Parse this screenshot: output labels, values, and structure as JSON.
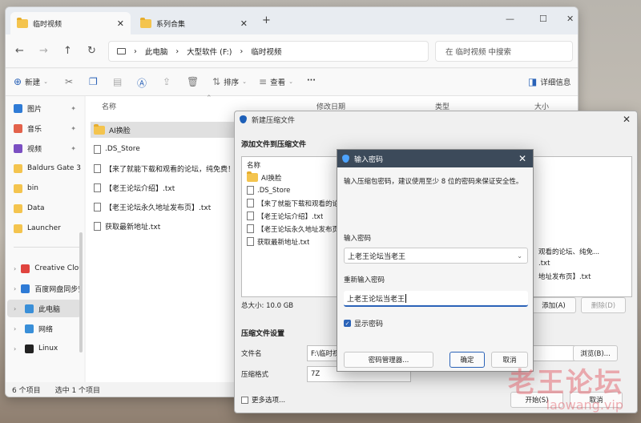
{
  "explorer": {
    "tabs": [
      {
        "label": "临时视频",
        "close": "✕"
      },
      {
        "label": "系列合集",
        "close": "✕"
      }
    ],
    "new_tab": "+",
    "window_controls": {
      "minimize": "—",
      "maximize": "☐",
      "close": "✕"
    },
    "nav_icons": {
      "back": "←",
      "forward": "→",
      "up": "↑",
      "refresh": "↻"
    },
    "breadcrumb": [
      "此电脑",
      "大型软件 (F:)",
      "临时视频"
    ],
    "breadcrumb_sep": "›",
    "search_placeholder": "在 临时视频 中搜索",
    "toolbar": {
      "new_label": "新建",
      "sort_label": "排序",
      "view_label": "查看",
      "more_label": "···",
      "details_label": "详细信息"
    },
    "sidebar": {
      "quick": [
        {
          "label": "图片",
          "icon": "pictures-icon",
          "color": "#2f7bd6"
        },
        {
          "label": "音乐",
          "icon": "music-icon",
          "color": "#e3624b"
        },
        {
          "label": "视频",
          "icon": "videos-icon",
          "color": "#7b4fc2"
        },
        {
          "label": "Baldurs Gate 3",
          "icon": "folder-icon",
          "color": "#f4c44e"
        },
        {
          "label": "bin",
          "icon": "folder-icon",
          "color": "#f4c44e"
        },
        {
          "label": "Data",
          "icon": "folder-icon",
          "color": "#f4c44e"
        },
        {
          "label": "Launcher",
          "icon": "folder-icon",
          "color": "#f4c44e"
        }
      ],
      "tree": [
        {
          "label": "Creative Cloud",
          "icon": "creative-cloud-icon",
          "color": "#e0443e"
        },
        {
          "label": "百度网盘同步空",
          "icon": "baidu-netdisk-icon",
          "color": "#2f7bd6"
        },
        {
          "label": "此电脑",
          "icon": "this-pc-icon",
          "color": "#3a8fd8"
        },
        {
          "label": "网络",
          "icon": "network-icon",
          "color": "#3a8fd8"
        },
        {
          "label": "Linux",
          "icon": "linux-icon",
          "color": "#222222"
        }
      ]
    },
    "columns": {
      "name": "名称",
      "modified": "修改日期",
      "type": "类型",
      "size": "大小"
    },
    "files": [
      {
        "name": "AI换脸",
        "kind": "folder"
      },
      {
        "name": ".DS_Store",
        "kind": "file"
      },
      {
        "name": "【来了就能下载和观看的论坛，纯免费！】.txt",
        "kind": "file"
      },
      {
        "name": "【老王论坛介绍】.txt",
        "kind": "file"
      },
      {
        "name": "【老王论坛永久地址发布页】.txt",
        "kind": "file"
      },
      {
        "name": "获取最新地址.txt",
        "kind": "file"
      }
    ],
    "status": {
      "count": "6 个项目",
      "selected": "选中 1 个项目"
    }
  },
  "archive_dialog": {
    "title": "新建压缩文件",
    "close": "✕",
    "add_files_heading": "添加文件到压缩文件",
    "list_header": "名称",
    "list_items": [
      {
        "name": "AI换脸",
        "kind": "folder"
      },
      {
        "name": ".DS_Store",
        "kind": "file"
      },
      {
        "name": "【来了就能下载和观看的论坛、纯免...",
        "kind": "file"
      },
      {
        "name": "【老王论坛介绍】.txt",
        "kind": "file"
      },
      {
        "name": "【老王论坛永久地址发布页】.txt",
        "kind": "file"
      },
      {
        "name": "获取最新地址.txt",
        "kind": "file"
      }
    ],
    "right_fragments": [
      "观看的论坛、纯免...",
      ".txt",
      "地址发布页】.txt"
    ],
    "total_size": "总大小: 10.0 GB",
    "add_button": "添加(A)",
    "delete_button": "删除(D)",
    "settings_heading": "压缩文件设置",
    "filename_label": "文件名",
    "filename_value": "F:\\临时视频",
    "browse_button": "浏览(B)...",
    "format_label": "压缩格式",
    "format_value": "7Z",
    "more_options": "更多选项...",
    "start_button": "开始(S)",
    "cancel_button": "取消"
  },
  "password_dialog": {
    "title": "输入密码",
    "close": "✕",
    "description": "输入压缩包密码，建议使用至少 8 位的密码来保证安全性。",
    "enter_label": "输入密码",
    "enter_value": "上老王论坛当老王",
    "reenter_label": "重新输入密码",
    "reenter_value": "上老王论坛当老王",
    "show_password": "显示密码",
    "show_checked": true,
    "manager_button": "密码管理器...",
    "ok_button": "确定",
    "cancel_button": "取消"
  },
  "watermark": {
    "text": "老王论坛",
    "url": "laowang.vip"
  }
}
